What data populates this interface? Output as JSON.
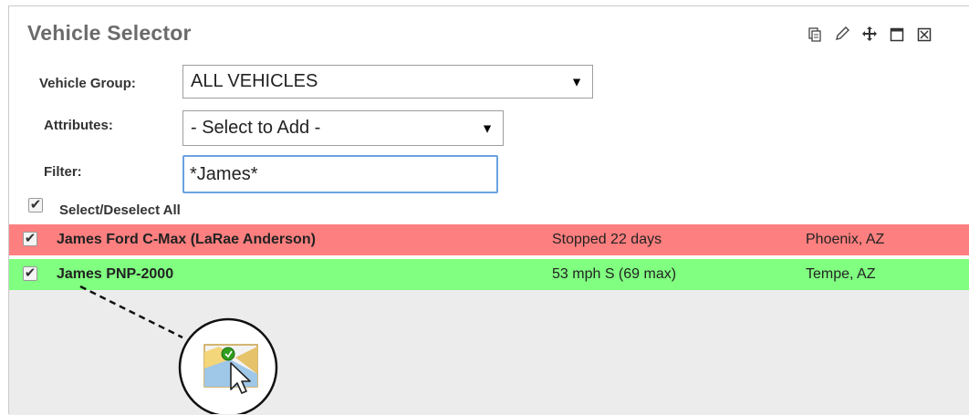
{
  "panel": {
    "title": "Vehicle Selector",
    "window_icons": [
      "copy-icon",
      "edit-icon",
      "move-icon",
      "maximize-icon",
      "close-icon"
    ]
  },
  "form": {
    "vehicle_group": {
      "label": "Vehicle Group:",
      "value": "ALL VEHICLES"
    },
    "attributes": {
      "label": "Attributes:",
      "value": "- Select to Add -"
    },
    "filter": {
      "label": "Filter:",
      "value": "*James*"
    },
    "select_all_label": "Select/Deselect All"
  },
  "vehicles": [
    {
      "name": "James Ford C-Max (LaRae Anderson)",
      "status": "Stopped 22 days",
      "location": "Phoenix, AZ",
      "checked": true,
      "color": "#fe7f7f"
    },
    {
      "name": "James PNP-2000",
      "status": "53 mph S (69 max)",
      "location": "Tempe, AZ",
      "checked": true,
      "color": "#80ff80"
    }
  ],
  "callout": {
    "icon": "map-locate-icon"
  }
}
